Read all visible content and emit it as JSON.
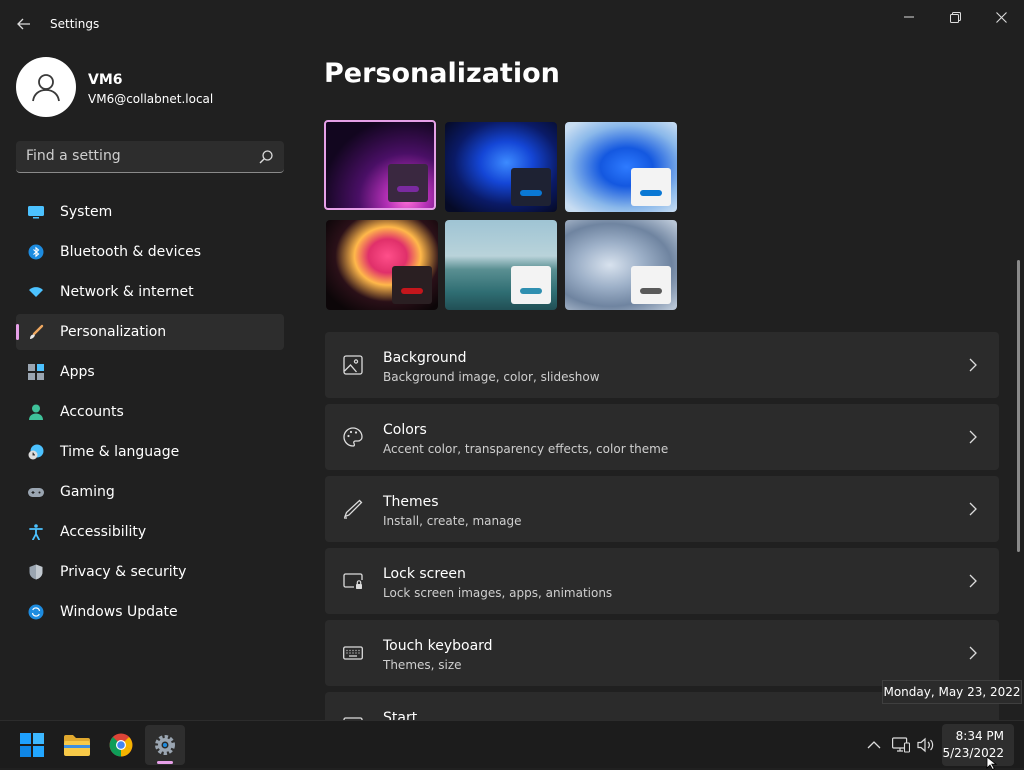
{
  "window": {
    "title": "Settings"
  },
  "profile": {
    "name": "VM6",
    "email": "VM6@collabnet.local"
  },
  "search": {
    "placeholder": "Find a setting"
  },
  "nav": {
    "items": [
      {
        "label": "System",
        "icon": "monitor-icon"
      },
      {
        "label": "Bluetooth & devices",
        "icon": "bluetooth-icon"
      },
      {
        "label": "Network & internet",
        "icon": "wifi-icon"
      },
      {
        "label": "Personalization",
        "icon": "brush-icon",
        "selected": true
      },
      {
        "label": "Apps",
        "icon": "apps-icon"
      },
      {
        "label": "Accounts",
        "icon": "person-icon"
      },
      {
        "label": "Time & language",
        "icon": "clock-globe-icon"
      },
      {
        "label": "Gaming",
        "icon": "gamepad-icon"
      },
      {
        "label": "Accessibility",
        "icon": "accessibility-icon"
      },
      {
        "label": "Privacy & security",
        "icon": "shield-icon"
      },
      {
        "label": "Windows Update",
        "icon": "update-icon"
      }
    ]
  },
  "main": {
    "title": "Personalization",
    "themes": [
      {
        "name": "theme-glow-purple",
        "accent": "#7a2aa0",
        "selected": true
      },
      {
        "name": "theme-bloom-dark",
        "accent": "#0a78d4"
      },
      {
        "name": "theme-bloom-light",
        "accent": "#0a78d4"
      },
      {
        "name": "theme-captured-motion",
        "accent": "#c4161c"
      },
      {
        "name": "theme-sunrise-lake",
        "accent": "#2f8fb0"
      },
      {
        "name": "theme-flow",
        "accent": "#5a5a5a"
      }
    ],
    "cards": [
      {
        "title": "Background",
        "subtitle": "Background image, color, slideshow",
        "icon": "image-icon"
      },
      {
        "title": "Colors",
        "subtitle": "Accent color, transparency effects, color theme",
        "icon": "palette-icon"
      },
      {
        "title": "Themes",
        "subtitle": "Install, create, manage",
        "icon": "pen-icon"
      },
      {
        "title": "Lock screen",
        "subtitle": "Lock screen images, apps, animations",
        "icon": "lock-screen-icon"
      },
      {
        "title": "Touch keyboard",
        "subtitle": "Themes, size",
        "icon": "keyboard-icon"
      },
      {
        "title": "Start",
        "subtitle": "",
        "icon": "start-icon"
      }
    ]
  },
  "tooltip": {
    "text": "Monday, May 23, 2022"
  },
  "taskbar": {
    "apps": [
      "start-icon",
      "file-explorer-icon",
      "chrome-icon",
      "settings-icon"
    ],
    "clock": {
      "time": "8:34 PM",
      "date": "5/23/2022"
    }
  },
  "colors": {
    "accent": "#e6a0e8",
    "background": "#202020",
    "card": "#2b2b2b"
  }
}
